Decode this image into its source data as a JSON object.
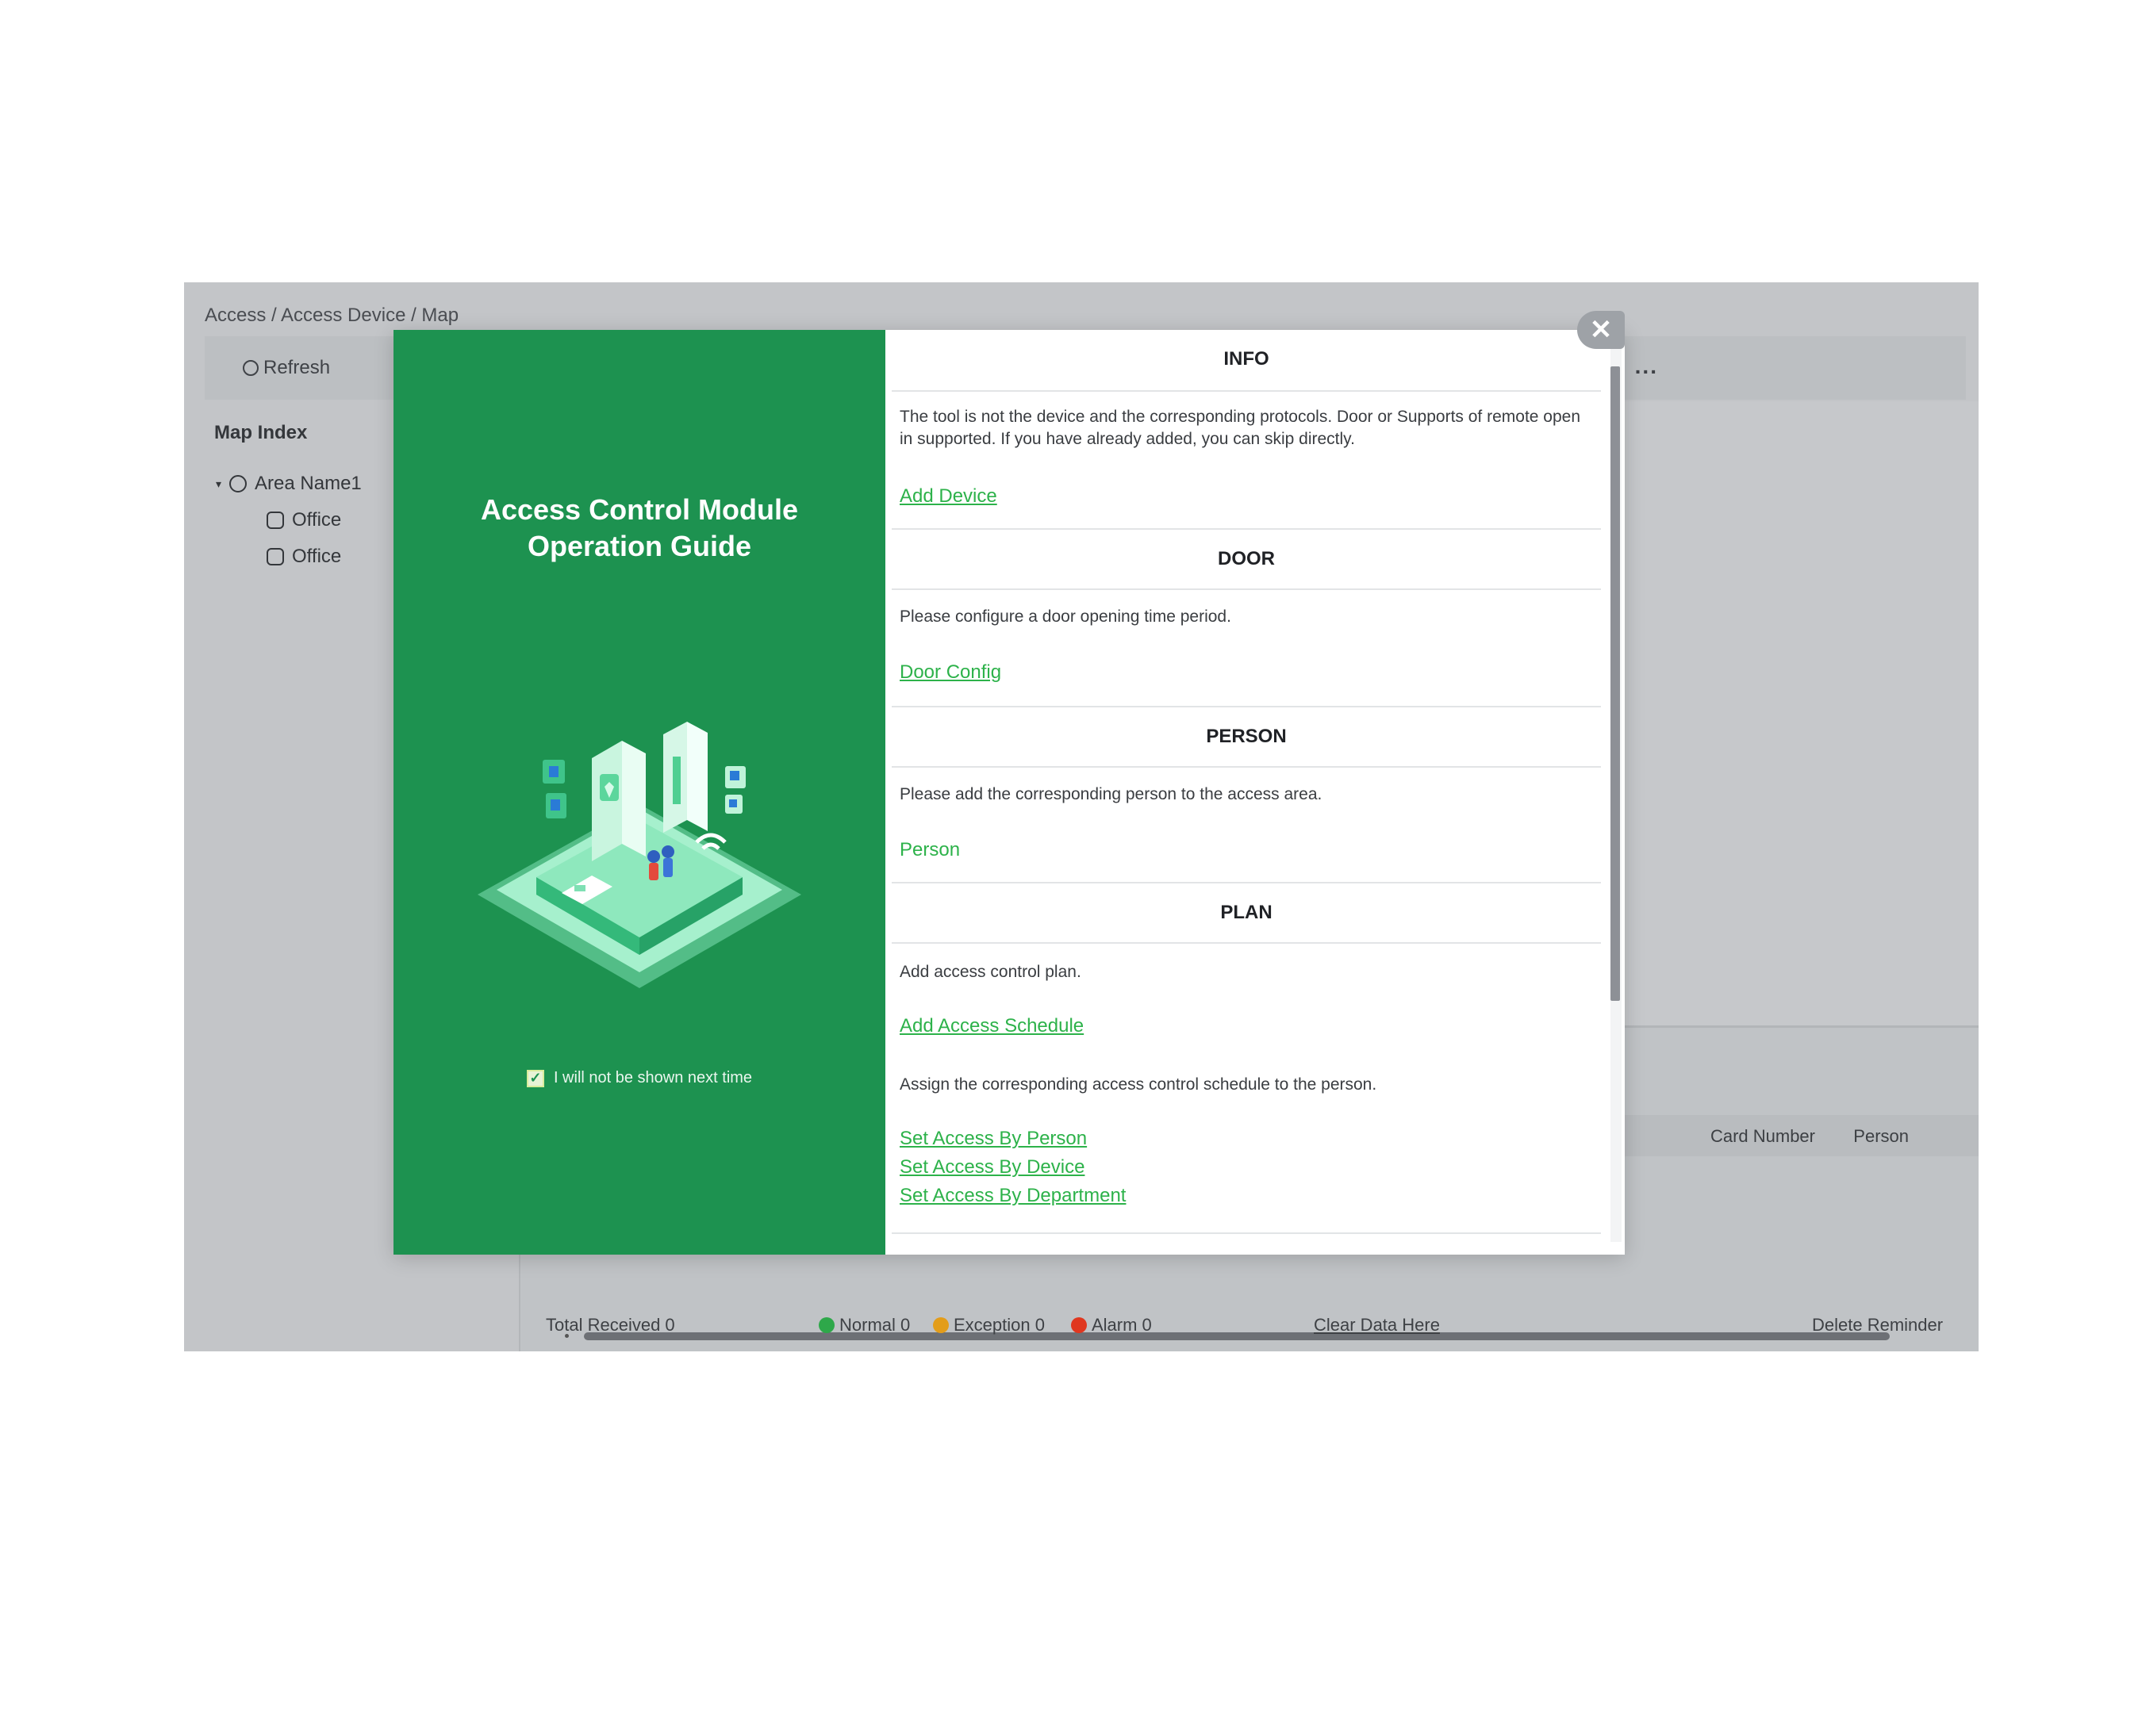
{
  "app": {
    "breadcrumb": "Access / Access Device / Map",
    "toolbar": {
      "refresh_label": "Refresh",
      "more_label": "..."
    },
    "sidebar": {
      "title": "Map Index",
      "tree": [
        {
          "label": "Area Name1",
          "level": 0
        },
        {
          "label": "Office",
          "level": 1
        },
        {
          "label": "Office",
          "level": 1
        }
      ]
    },
    "table": {
      "columns": [
        "Card Number",
        "Person"
      ]
    },
    "status": {
      "total": "Total Received 0",
      "normal": "Normal 0",
      "exception": "Exception 0",
      "alarm": "Alarm 0",
      "clear_label": "Clear Data Here",
      "delete_label": "Delete Reminder"
    },
    "colors": {
      "normal": "#2ea84a",
      "exception": "#e39d1a",
      "alarm": "#e0371f"
    }
  },
  "modal": {
    "close_icon": "close-icon",
    "left": {
      "title_line1": "Access Control Module",
      "title_line2": "Operation Guide",
      "dont_show_label": "I will not be shown next time",
      "accent": "#1d9250"
    },
    "sections": [
      {
        "heading": "INFO",
        "text": "The tool is not the device and the corresponding protocols. Door or Supports of remote open in supported. If you have already added, you can skip directly.",
        "links": [
          "Add Device"
        ]
      },
      {
        "heading": "DOOR",
        "text": "Please configure a door opening time period.",
        "links": [
          "Door Config"
        ]
      },
      {
        "heading": "PERSON",
        "text": "Please add the corresponding person to the access area.",
        "links": [
          "Person"
        ]
      },
      {
        "heading": "PLAN",
        "text": "Add access control plan.",
        "links": [
          "Add Access Schedule"
        ],
        "text2": "Assign the corresponding access control schedule to the person.",
        "links2": [
          "Set Access By Person",
          "Set Access By Device",
          "Set Access By Department"
        ]
      }
    ]
  }
}
